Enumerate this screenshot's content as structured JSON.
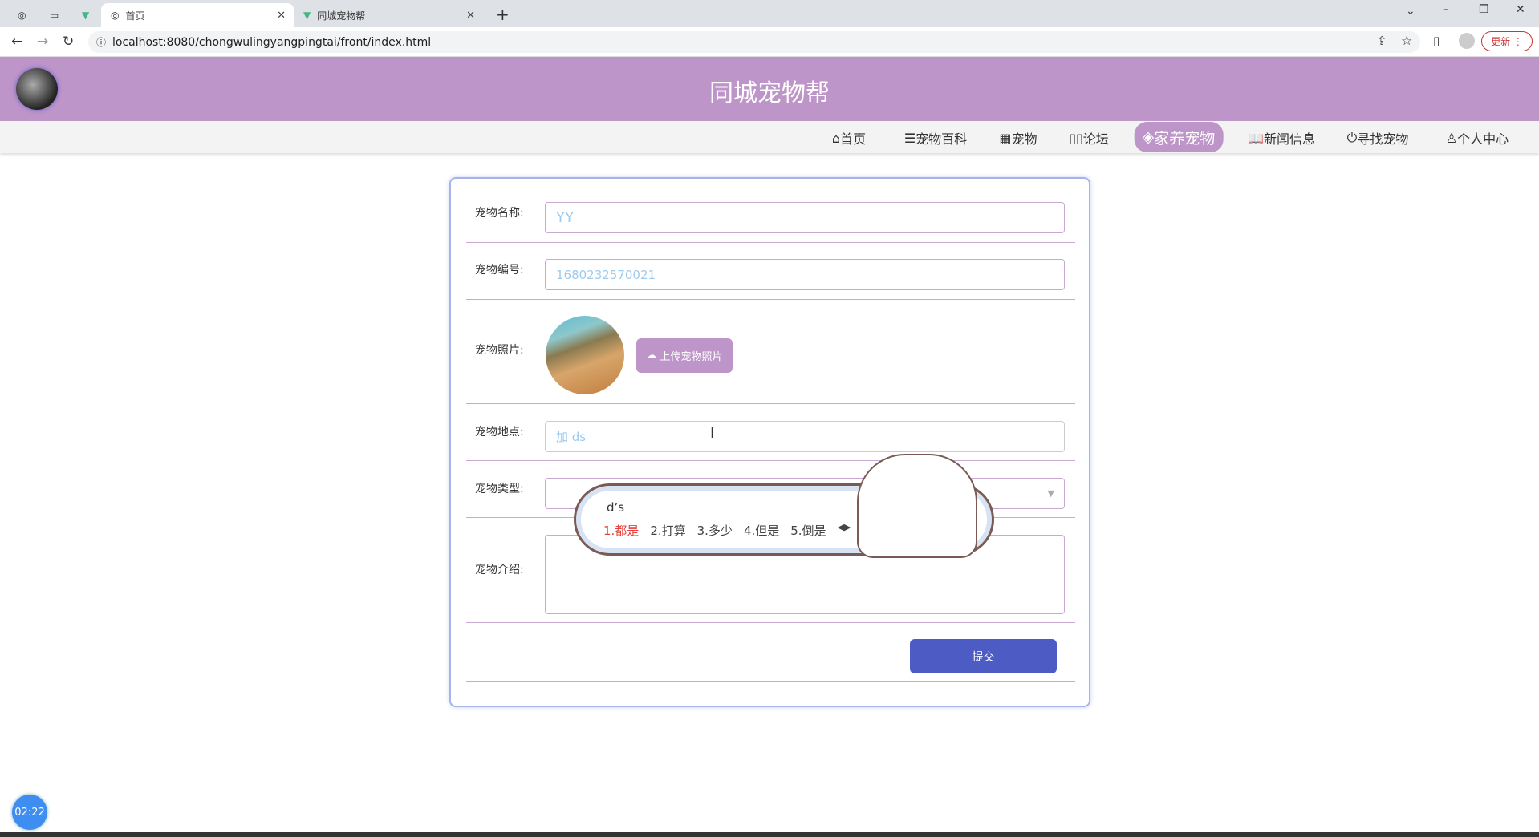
{
  "browser": {
    "tabs": [
      {
        "label": "首页",
        "active": true
      },
      {
        "label": "同城宠物帮",
        "active": false
      }
    ],
    "url": "localhost:8080/chongwulingyangpingtai/front/index.html",
    "update_label": "更新"
  },
  "header": {
    "title": "同城宠物帮"
  },
  "nav": {
    "items": [
      {
        "icon": "home-icon",
        "label": "首页"
      },
      {
        "icon": "sliders-icon",
        "label": "宠物百科"
      },
      {
        "icon": "grid-icon",
        "label": "宠物"
      },
      {
        "icon": "forum-icon",
        "label": "论坛"
      },
      {
        "icon": "layers-icon",
        "label": "家养宠物",
        "active": true
      },
      {
        "icon": "book-icon",
        "label": "新闻信息"
      },
      {
        "icon": "power-icon",
        "label": "寻找宠物"
      },
      {
        "icon": "user-icon",
        "label": "个人中心"
      }
    ]
  },
  "form": {
    "name_label": "宠物名称:",
    "name_value": "YY",
    "code_label": "宠物编号:",
    "code_value": "1680232570021",
    "photo_label": "宠物照片:",
    "upload_label": "上传宠物照片",
    "location_label": "宠物地点:",
    "location_value": "加 ds",
    "type_label": "宠物类型:",
    "type_value": "",
    "intro_label": "宠物介绍:",
    "intro_value": "",
    "submit_label": "提交"
  },
  "ime": {
    "input": "d’s",
    "candidates": [
      "1.都是",
      "2.打算",
      "3.多少",
      "4.但是",
      "5.倒是"
    ],
    "highlight_color": "#e8413b"
  },
  "timer": {
    "text": "02:22"
  },
  "colors": {
    "brand": "#bd95c8",
    "submit": "#4d5bc5",
    "input_text": "#9ccbef"
  }
}
